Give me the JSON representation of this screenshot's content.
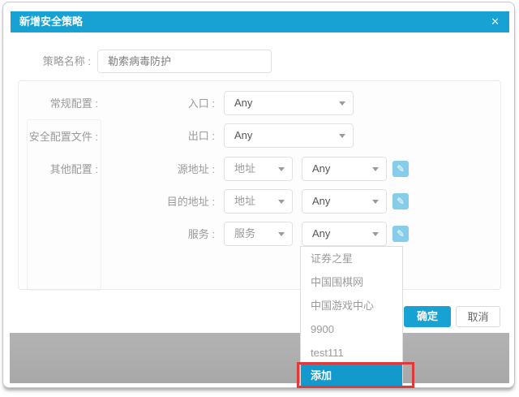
{
  "dialog": {
    "title": "新增安全策略",
    "close_icon": "✕"
  },
  "policy_name": {
    "label": "策略名称 :",
    "value": "勒索病毒防护"
  },
  "sections": {
    "general": "常规配置 :",
    "security_profile": "安全配置文件 :",
    "other": "其他配置 :"
  },
  "form": {
    "inlet": {
      "label": "入口 :",
      "value": "Any"
    },
    "outlet": {
      "label": "出口 :",
      "value": "Any"
    },
    "source_address": {
      "label": "源地址 :",
      "type": "地址",
      "value": "Any"
    },
    "destination_address": {
      "label": "目的地址 :",
      "type": "地址",
      "value": "Any"
    },
    "service": {
      "label": "服务 :",
      "type": "服务",
      "value": "Any"
    }
  },
  "service_dropdown": {
    "options": [
      "证券之星",
      "中国围棋网",
      "中国游戏中心",
      "9900",
      "test111"
    ],
    "add_option": "添加"
  },
  "footer": {
    "ok": "确定",
    "cancel": "取消"
  },
  "icons": {
    "edit": "✎"
  },
  "colors": {
    "primary_blue": "#17a2d3",
    "selected_blue": "#1499cc",
    "annotation_red": "#e0393c",
    "edit_icon_blue": "#85cde8",
    "overlay_gray": "#aeaeae"
  }
}
